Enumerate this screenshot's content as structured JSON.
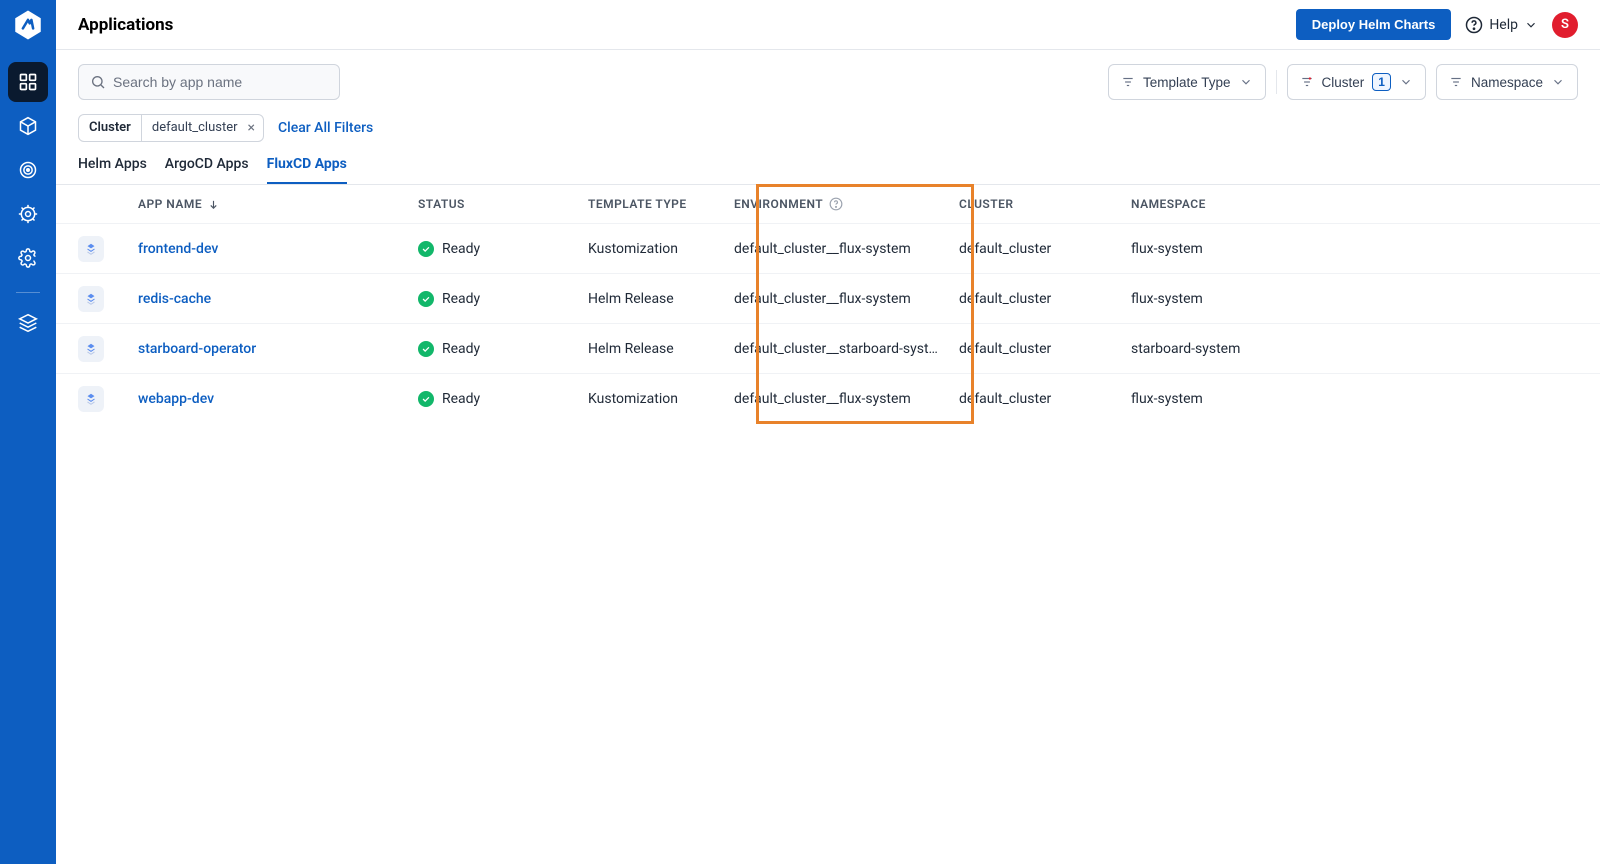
{
  "header": {
    "title": "Applications",
    "deploy_btn": "Deploy Helm Charts",
    "help": "Help",
    "avatar_initial": "S"
  },
  "toolbar": {
    "search_placeholder": "Search by app name",
    "filters": {
      "template_type": "Template Type",
      "cluster": "Cluster",
      "cluster_count": "1",
      "namespace": "Namespace"
    }
  },
  "chip": {
    "key": "Cluster",
    "value": "default_cluster",
    "clear_all": "Clear All Filters"
  },
  "tabs": [
    "Helm Apps",
    "ArgoCD Apps",
    "FluxCD Apps"
  ],
  "active_tab": 2,
  "columns": {
    "app_name": "App Name",
    "status": "Status",
    "template_type": "Template Type",
    "environment": "Environment",
    "cluster": "Cluster",
    "namespace": "Namespace"
  },
  "rows": [
    {
      "name": "frontend-dev",
      "status": "Ready",
      "template": "Kustomization",
      "env": "default_cluster__flux-system",
      "cluster": "default_cluster",
      "ns": "flux-system"
    },
    {
      "name": "redis-cache",
      "status": "Ready",
      "template": "Helm Release",
      "env": "default_cluster__flux-system",
      "cluster": "default_cluster",
      "ns": "flux-system"
    },
    {
      "name": "starboard-operator",
      "status": "Ready",
      "template": "Helm Release",
      "env": "default_cluster__starboard-syst…",
      "cluster": "default_cluster",
      "ns": "starboard-system"
    },
    {
      "name": "webapp-dev",
      "status": "Ready",
      "template": "Kustomization",
      "env": "default_cluster__flux-system",
      "cluster": "default_cluster",
      "ns": "flux-system"
    }
  ]
}
